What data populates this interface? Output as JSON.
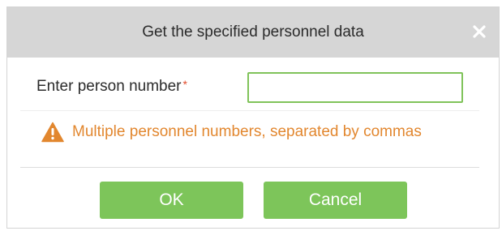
{
  "dialog": {
    "title": "Get the specified personnel data",
    "close_icon": "close-icon"
  },
  "form": {
    "label": "Enter person number",
    "required_marker": "*",
    "input_value": ""
  },
  "hint": {
    "icon": "warning-icon",
    "text": "Multiple personnel numbers, separated by commas"
  },
  "buttons": {
    "ok_label": "OK",
    "cancel_label": "Cancel"
  },
  "colors": {
    "accent": "#7dc55a",
    "warning": "#e2872f",
    "required": "#e24b2c",
    "titlebar": "#d6d6d6"
  }
}
